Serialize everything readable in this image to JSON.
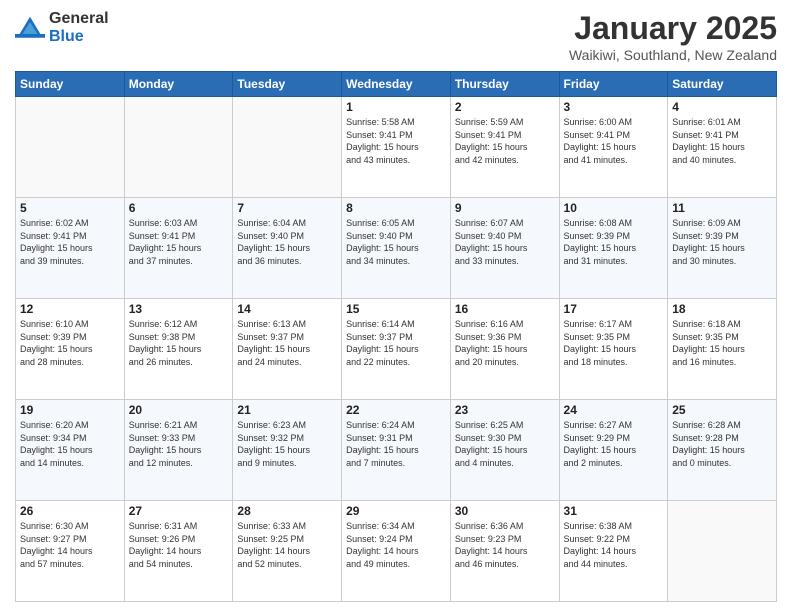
{
  "logo": {
    "general": "General",
    "blue": "Blue"
  },
  "header": {
    "month": "January 2025",
    "location": "Waikiwi, Southland, New Zealand"
  },
  "days_of_week": [
    "Sunday",
    "Monday",
    "Tuesday",
    "Wednesday",
    "Thursday",
    "Friday",
    "Saturday"
  ],
  "weeks": [
    [
      {
        "day": "",
        "info": ""
      },
      {
        "day": "",
        "info": ""
      },
      {
        "day": "",
        "info": ""
      },
      {
        "day": "1",
        "info": "Sunrise: 5:58 AM\nSunset: 9:41 PM\nDaylight: 15 hours\nand 43 minutes."
      },
      {
        "day": "2",
        "info": "Sunrise: 5:59 AM\nSunset: 9:41 PM\nDaylight: 15 hours\nand 42 minutes."
      },
      {
        "day": "3",
        "info": "Sunrise: 6:00 AM\nSunset: 9:41 PM\nDaylight: 15 hours\nand 41 minutes."
      },
      {
        "day": "4",
        "info": "Sunrise: 6:01 AM\nSunset: 9:41 PM\nDaylight: 15 hours\nand 40 minutes."
      }
    ],
    [
      {
        "day": "5",
        "info": "Sunrise: 6:02 AM\nSunset: 9:41 PM\nDaylight: 15 hours\nand 39 minutes."
      },
      {
        "day": "6",
        "info": "Sunrise: 6:03 AM\nSunset: 9:41 PM\nDaylight: 15 hours\nand 37 minutes."
      },
      {
        "day": "7",
        "info": "Sunrise: 6:04 AM\nSunset: 9:40 PM\nDaylight: 15 hours\nand 36 minutes."
      },
      {
        "day": "8",
        "info": "Sunrise: 6:05 AM\nSunset: 9:40 PM\nDaylight: 15 hours\nand 34 minutes."
      },
      {
        "day": "9",
        "info": "Sunrise: 6:07 AM\nSunset: 9:40 PM\nDaylight: 15 hours\nand 33 minutes."
      },
      {
        "day": "10",
        "info": "Sunrise: 6:08 AM\nSunset: 9:39 PM\nDaylight: 15 hours\nand 31 minutes."
      },
      {
        "day": "11",
        "info": "Sunrise: 6:09 AM\nSunset: 9:39 PM\nDaylight: 15 hours\nand 30 minutes."
      }
    ],
    [
      {
        "day": "12",
        "info": "Sunrise: 6:10 AM\nSunset: 9:39 PM\nDaylight: 15 hours\nand 28 minutes."
      },
      {
        "day": "13",
        "info": "Sunrise: 6:12 AM\nSunset: 9:38 PM\nDaylight: 15 hours\nand 26 minutes."
      },
      {
        "day": "14",
        "info": "Sunrise: 6:13 AM\nSunset: 9:37 PM\nDaylight: 15 hours\nand 24 minutes."
      },
      {
        "day": "15",
        "info": "Sunrise: 6:14 AM\nSunset: 9:37 PM\nDaylight: 15 hours\nand 22 minutes."
      },
      {
        "day": "16",
        "info": "Sunrise: 6:16 AM\nSunset: 9:36 PM\nDaylight: 15 hours\nand 20 minutes."
      },
      {
        "day": "17",
        "info": "Sunrise: 6:17 AM\nSunset: 9:35 PM\nDaylight: 15 hours\nand 18 minutes."
      },
      {
        "day": "18",
        "info": "Sunrise: 6:18 AM\nSunset: 9:35 PM\nDaylight: 15 hours\nand 16 minutes."
      }
    ],
    [
      {
        "day": "19",
        "info": "Sunrise: 6:20 AM\nSunset: 9:34 PM\nDaylight: 15 hours\nand 14 minutes."
      },
      {
        "day": "20",
        "info": "Sunrise: 6:21 AM\nSunset: 9:33 PM\nDaylight: 15 hours\nand 12 minutes."
      },
      {
        "day": "21",
        "info": "Sunrise: 6:23 AM\nSunset: 9:32 PM\nDaylight: 15 hours\nand 9 minutes."
      },
      {
        "day": "22",
        "info": "Sunrise: 6:24 AM\nSunset: 9:31 PM\nDaylight: 15 hours\nand 7 minutes."
      },
      {
        "day": "23",
        "info": "Sunrise: 6:25 AM\nSunset: 9:30 PM\nDaylight: 15 hours\nand 4 minutes."
      },
      {
        "day": "24",
        "info": "Sunrise: 6:27 AM\nSunset: 9:29 PM\nDaylight: 15 hours\nand 2 minutes."
      },
      {
        "day": "25",
        "info": "Sunrise: 6:28 AM\nSunset: 9:28 PM\nDaylight: 15 hours\nand 0 minutes."
      }
    ],
    [
      {
        "day": "26",
        "info": "Sunrise: 6:30 AM\nSunset: 9:27 PM\nDaylight: 14 hours\nand 57 minutes."
      },
      {
        "day": "27",
        "info": "Sunrise: 6:31 AM\nSunset: 9:26 PM\nDaylight: 14 hours\nand 54 minutes."
      },
      {
        "day": "28",
        "info": "Sunrise: 6:33 AM\nSunset: 9:25 PM\nDaylight: 14 hours\nand 52 minutes."
      },
      {
        "day": "29",
        "info": "Sunrise: 6:34 AM\nSunset: 9:24 PM\nDaylight: 14 hours\nand 49 minutes."
      },
      {
        "day": "30",
        "info": "Sunrise: 6:36 AM\nSunset: 9:23 PM\nDaylight: 14 hours\nand 46 minutes."
      },
      {
        "day": "31",
        "info": "Sunrise: 6:38 AM\nSunset: 9:22 PM\nDaylight: 14 hours\nand 44 minutes."
      },
      {
        "day": "",
        "info": ""
      }
    ]
  ]
}
